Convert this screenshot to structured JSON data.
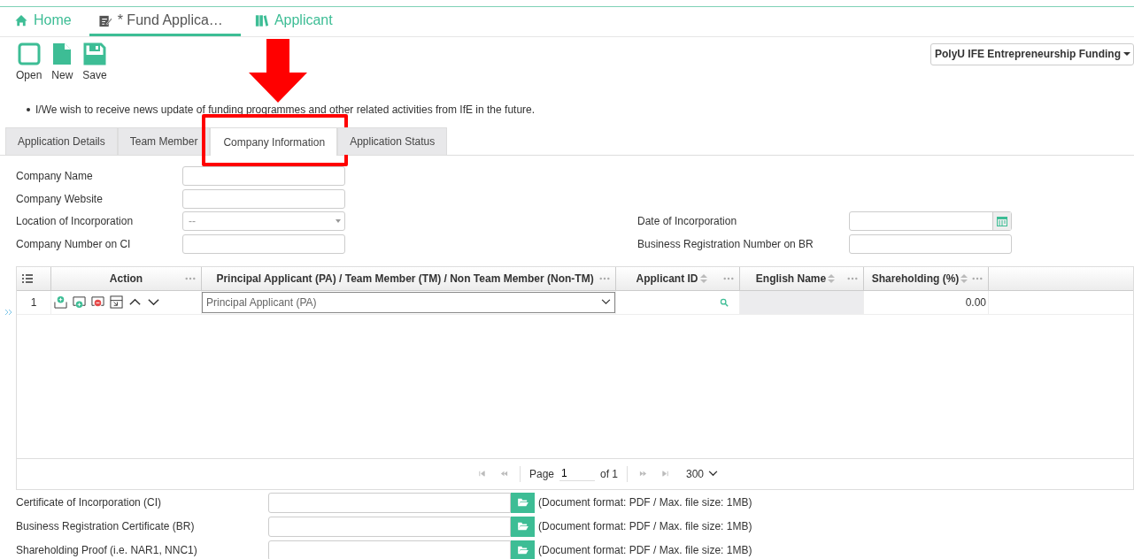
{
  "nav_tabs": [
    {
      "label": "Home",
      "selected": false
    },
    {
      "label": "* Fund Applica…",
      "selected": true
    },
    {
      "label": "Applicant",
      "selected": false
    }
  ],
  "toolbar": [
    {
      "label": "Open"
    },
    {
      "label": "New"
    },
    {
      "label": "Save"
    }
  ],
  "programme_select": {
    "value": "PolyU IFE Entrepreneurship Funding"
  },
  "notice": "I/We wish to receive news update of funding programmes and other related activities from IfE in the future.",
  "form_tabs": [
    {
      "label": "Application Details",
      "selected": false,
      "highlighted": false
    },
    {
      "label": "Team Member",
      "selected": false,
      "highlighted": false
    },
    {
      "label": "Company Information",
      "selected": true,
      "highlighted": true
    },
    {
      "label": "Application Status",
      "selected": false,
      "highlighted": false
    }
  ],
  "fields_left": [
    {
      "label": "Company Name",
      "kind": "text"
    },
    {
      "label": "Company Website",
      "kind": "text"
    },
    {
      "label": "Location of Incorporation",
      "kind": "select",
      "value": "--"
    },
    {
      "label": "Company Number on CI",
      "kind": "text"
    }
  ],
  "fields_right": [
    {
      "label": "Date of Incorporation",
      "kind": "date"
    },
    {
      "label": "Business Registration Number on BR",
      "kind": "text"
    }
  ],
  "grid": {
    "columns": [
      {
        "label": "Action",
        "sortable": false
      },
      {
        "label": "Principal Applicant (PA) / Team Member (TM) / Non Team Member (Non-TM)",
        "sortable": false
      },
      {
        "label": "Applicant ID",
        "sortable": true
      },
      {
        "label": "English Name",
        "sortable": true
      },
      {
        "label": "Shareholding (%)",
        "sortable": true
      }
    ],
    "rows": [
      {
        "number": "1",
        "member_type": "Principal Applicant (PA)",
        "shareholding": "0.00"
      }
    ],
    "pager": {
      "page_label": "Page",
      "page": "1",
      "of": "of 1",
      "page_size": "300"
    }
  },
  "uploads": [
    {
      "label": "Certificate of Incorporation (CI)",
      "note": "(Document format: PDF / Max. file size: 1MB)"
    },
    {
      "label": "Business Registration Certificate (BR)",
      "note": "(Document format: PDF / Max. file size: 1MB)"
    },
    {
      "label": "Shareholding Proof (i.e. NAR1, NNC1)",
      "note": "(Document format: PDF / Max. file size: 1MB)"
    }
  ]
}
